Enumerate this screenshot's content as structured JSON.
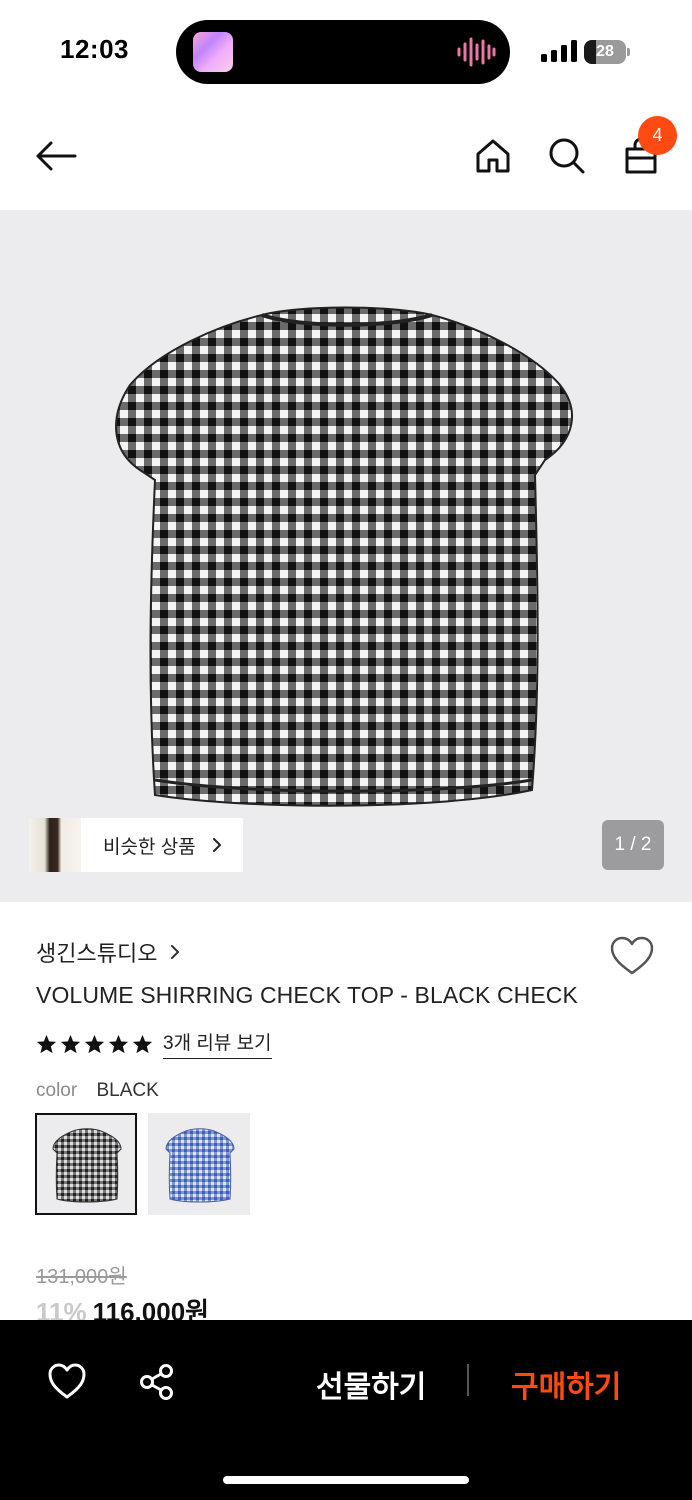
{
  "status_bar": {
    "time": "12:03",
    "battery": "28",
    "battery_level": 0.28
  },
  "header": {
    "back_icon": "arrow-left-icon",
    "home_icon": "home-icon",
    "search_icon": "search-icon",
    "cart_icon": "shopping-bag-icon",
    "cart_count": "4",
    "accent_color": "#ff4b12"
  },
  "gallery": {
    "similar_label": "비슷한 상품",
    "pager": "1 / 2",
    "background_color": "#ececee"
  },
  "product": {
    "brand": "생긴스튜디오",
    "title": "VOLUME SHIRRING CHECK TOP - BLACK CHECK",
    "rating": 5,
    "review_link": "3개 리뷰 보기",
    "color_key": "color",
    "color_value": "BLACK",
    "swatches": [
      "black-check",
      "blue-check"
    ],
    "selected_swatch": 0,
    "original_price": "131,000원",
    "discount": "11%",
    "price": "116,000원"
  },
  "bottom_bar": {
    "wishlist_icon": "heart-icon",
    "share_icon": "share-icon",
    "gift_label": "선물하기",
    "buy_label": "구매하기"
  }
}
